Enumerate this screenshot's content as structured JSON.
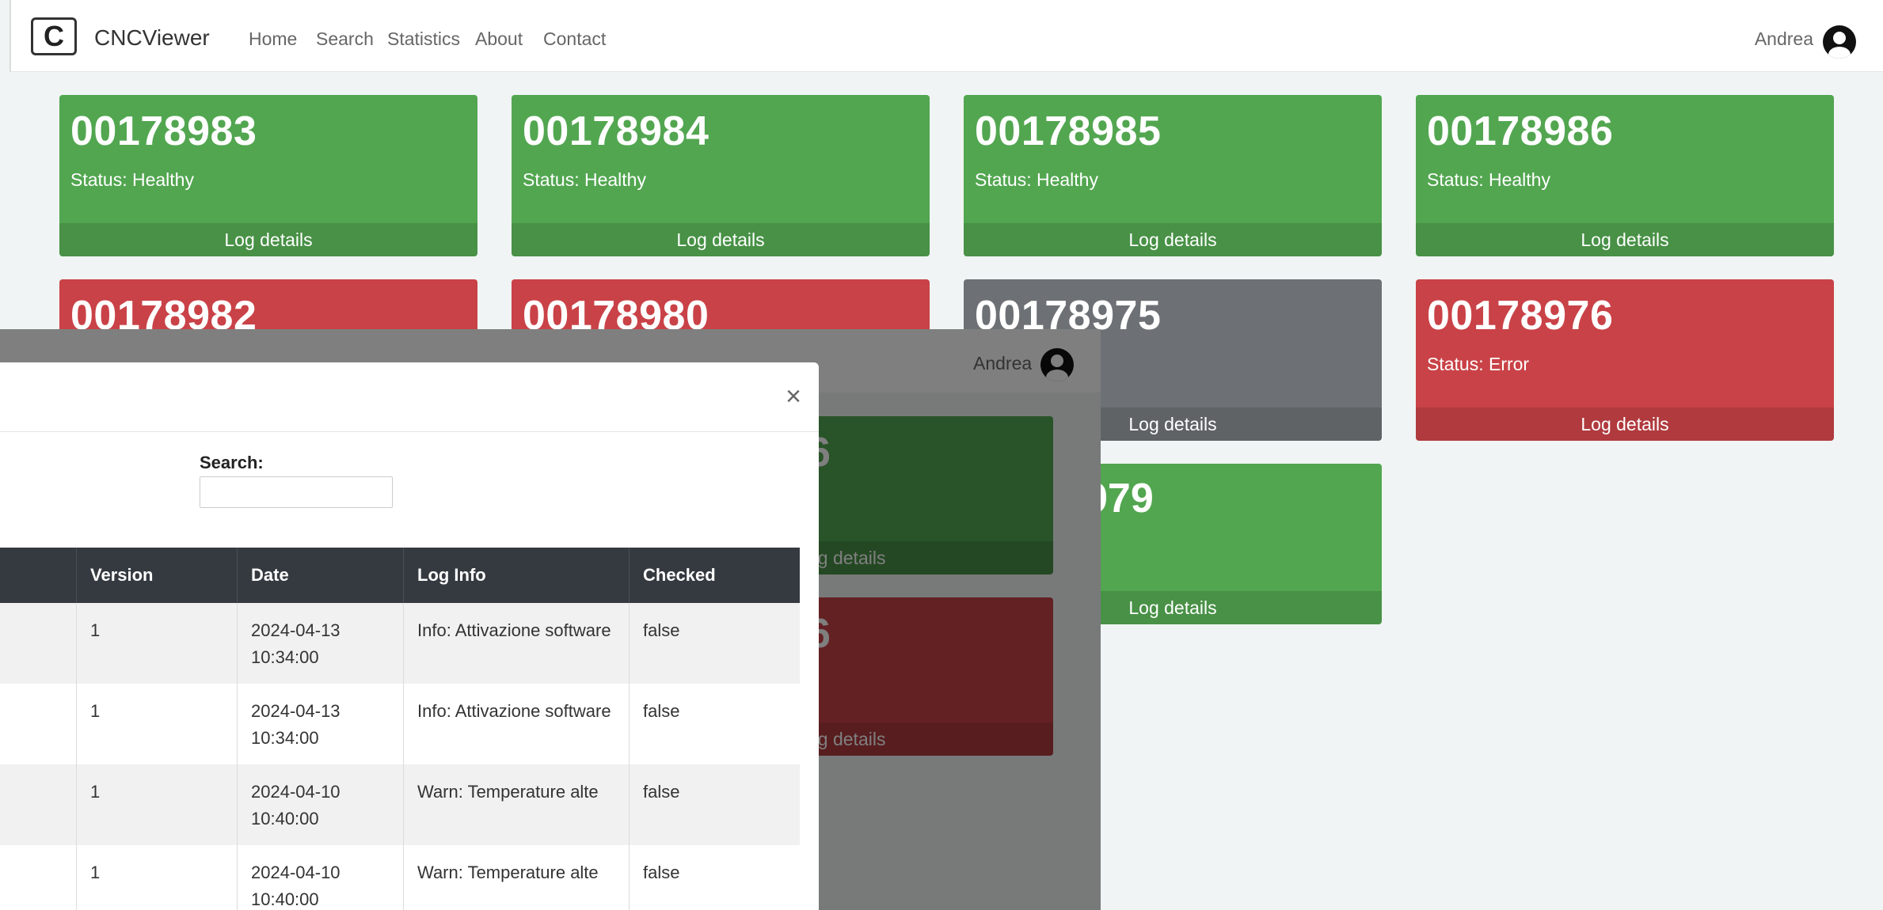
{
  "app": {
    "brand_letter": "C",
    "brand_name": "CNCViewer",
    "nav": [
      "Home",
      "Search",
      "Statistics",
      "About",
      "Contact"
    ],
    "user": "Andrea"
  },
  "cards": [
    {
      "id": "00178983",
      "status": "Status: Healthy",
      "footer": "Log details",
      "color": "#52a650"
    },
    {
      "id": "00178984",
      "status": "Status: Healthy",
      "footer": "Log details",
      "color": "#52a650"
    },
    {
      "id": "00178985",
      "status": "Status: Healthy",
      "footer": "Log details",
      "color": "#52a650"
    },
    {
      "id": "00178986",
      "status": "Status: Healthy",
      "footer": "Log details",
      "color": "#52a650"
    },
    {
      "id": "00178982",
      "status": "",
      "footer": "",
      "color": "#c94247"
    },
    {
      "id": "00178980",
      "status": "",
      "footer": "",
      "color": "#c94247"
    },
    {
      "id": "00178975",
      "status": "",
      "footer": "Log details",
      "color": "#6d7175"
    },
    {
      "id": "00178976",
      "status": "Status: Error",
      "footer": "Log details",
      "color": "#c94247"
    },
    {
      "id": "979",
      "status": "",
      "footer": "Log details",
      "color": "#52a650"
    }
  ],
  "overlay": {
    "user": "Andrea",
    "cards": [
      {
        "id": "6",
        "footer": "og details",
        "color": "#52a650"
      },
      {
        "id": "6",
        "footer": "og details",
        "color": "#c94247"
      }
    ]
  },
  "modal": {
    "close_label": "×",
    "search_label": "Search:",
    "search_value": "",
    "columns": [
      "Version",
      "Date",
      "Log Info",
      "Checked"
    ],
    "rows": [
      {
        "version": "1",
        "date": "2024-04-13 10:34:00",
        "info": "Info: Attivazione software",
        "checked": "false"
      },
      {
        "version": "1",
        "date": "2024-04-13 10:34:00",
        "info": "Info: Attivazione software",
        "checked": "false"
      },
      {
        "version": "1",
        "date": "2024-04-10 10:40:00",
        "info": "Warn: Temperature alte",
        "checked": "false"
      },
      {
        "version": "1",
        "date": "2024-04-10 10:40:00",
        "info": "Warn: Temperature alte",
        "checked": "false"
      }
    ]
  },
  "colors": {
    "healthy": "#52a650",
    "error": "#c94247",
    "offline": "#6d7175",
    "table_header": "#353a40"
  }
}
